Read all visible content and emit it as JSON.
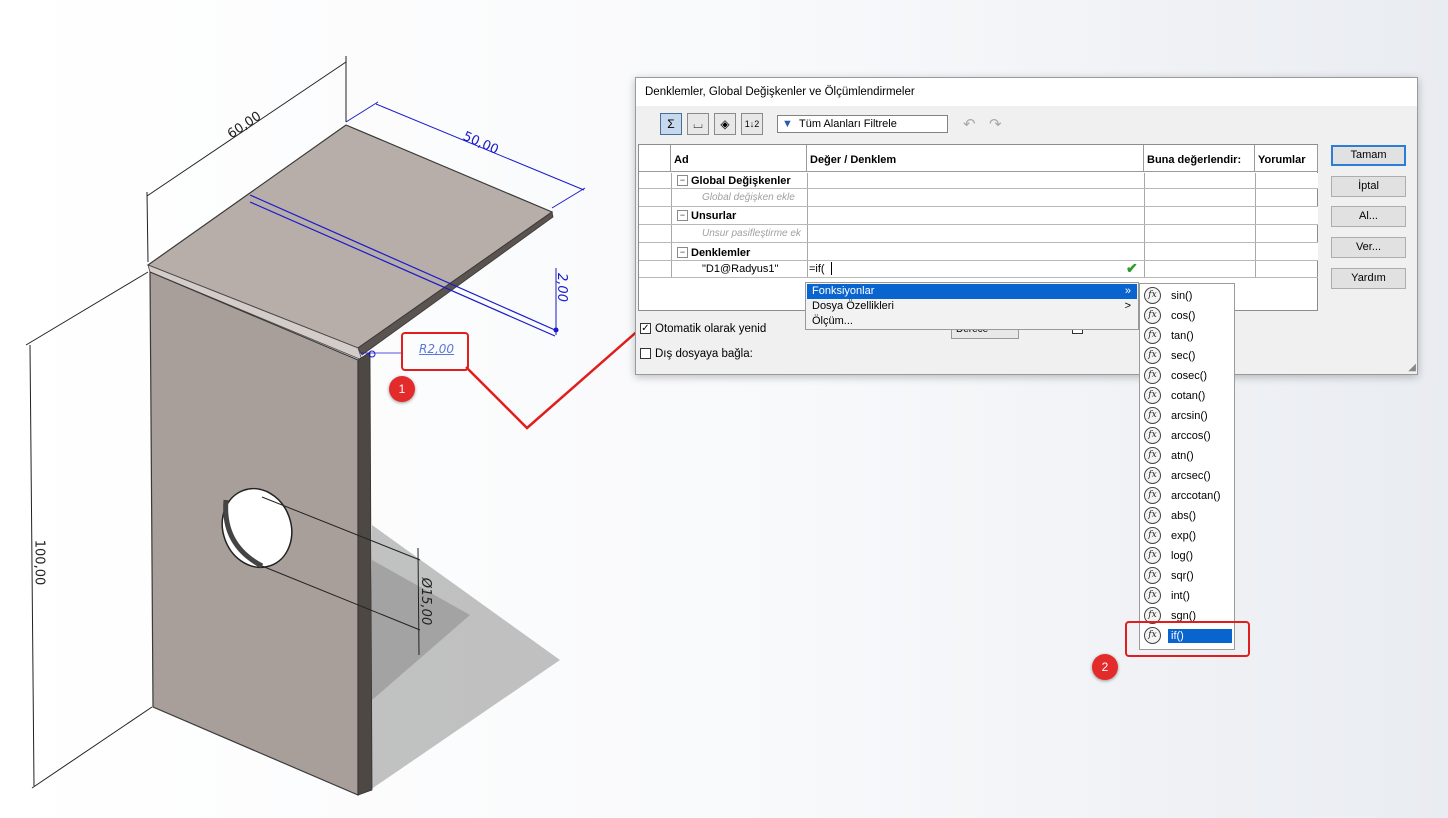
{
  "viewport": {
    "dims": {
      "width": "60,00",
      "depth": "50,00",
      "thickness": "2,00",
      "radius": "R2,00",
      "height": "100,00",
      "hole": "Ø15,00"
    },
    "colors": {
      "part_top": "#b8aea9",
      "part_front": "#a89f9a",
      "dimension_blue": "#1a1acc",
      "annotation_red": "#e01e1e"
    }
  },
  "dialog": {
    "title": "Denklemler, Global Değişkenler ve Ölçümlendirmeler",
    "toolbar": {
      "filter_text": "Tüm Alanları Filtrele",
      "icons": [
        "equation-view-icon",
        "sketch-view-icon",
        "dependency-view-icon",
        "ordered-view-icon",
        "filter-icon",
        "undo-icon",
        "redo-icon"
      ]
    },
    "table": {
      "headers": [
        "Ad",
        "Değer / Denklem",
        "Buna değerlendir:",
        "Yorumlar"
      ],
      "sections": [
        {
          "label": "Global Değişkenler",
          "hint": "Global değişken ekle"
        },
        {
          "label": "Unsurlar",
          "hint": "Unsur pasifleştirme ek"
        },
        {
          "label": "Denklemler"
        }
      ],
      "equation_row": {
        "name": "\"D1@Radyus1\"",
        "value": "=if("
      }
    },
    "buttons": {
      "ok": "Tamam",
      "cancel": "İptal",
      "import": "Al...",
      "export": "Ver...",
      "help": "Yardım"
    },
    "options": {
      "auto_rebuild": "Otomatik olarak yenid",
      "link_external": "Dış dosyaya bağla:",
      "angle_units_value": "Derece"
    }
  },
  "context_menu": {
    "items": [
      {
        "label": "Fonksiyonlar",
        "arrow": "»"
      },
      {
        "label": "Dosya Özellikleri",
        "arrow": ">"
      },
      {
        "label": "Ölçüm..."
      }
    ]
  },
  "functions": [
    "sin()",
    "cos()",
    "tan()",
    "sec()",
    "cosec()",
    "cotan()",
    "arcsin()",
    "arccos()",
    "atn()",
    "arcsec()",
    "arccotan()",
    "abs()",
    "exp()",
    "log()",
    "sqr()",
    "int()",
    "sgn()",
    "if()"
  ],
  "selected_function": "if()",
  "annotations": {
    "badge1": "1",
    "badge2": "2"
  }
}
